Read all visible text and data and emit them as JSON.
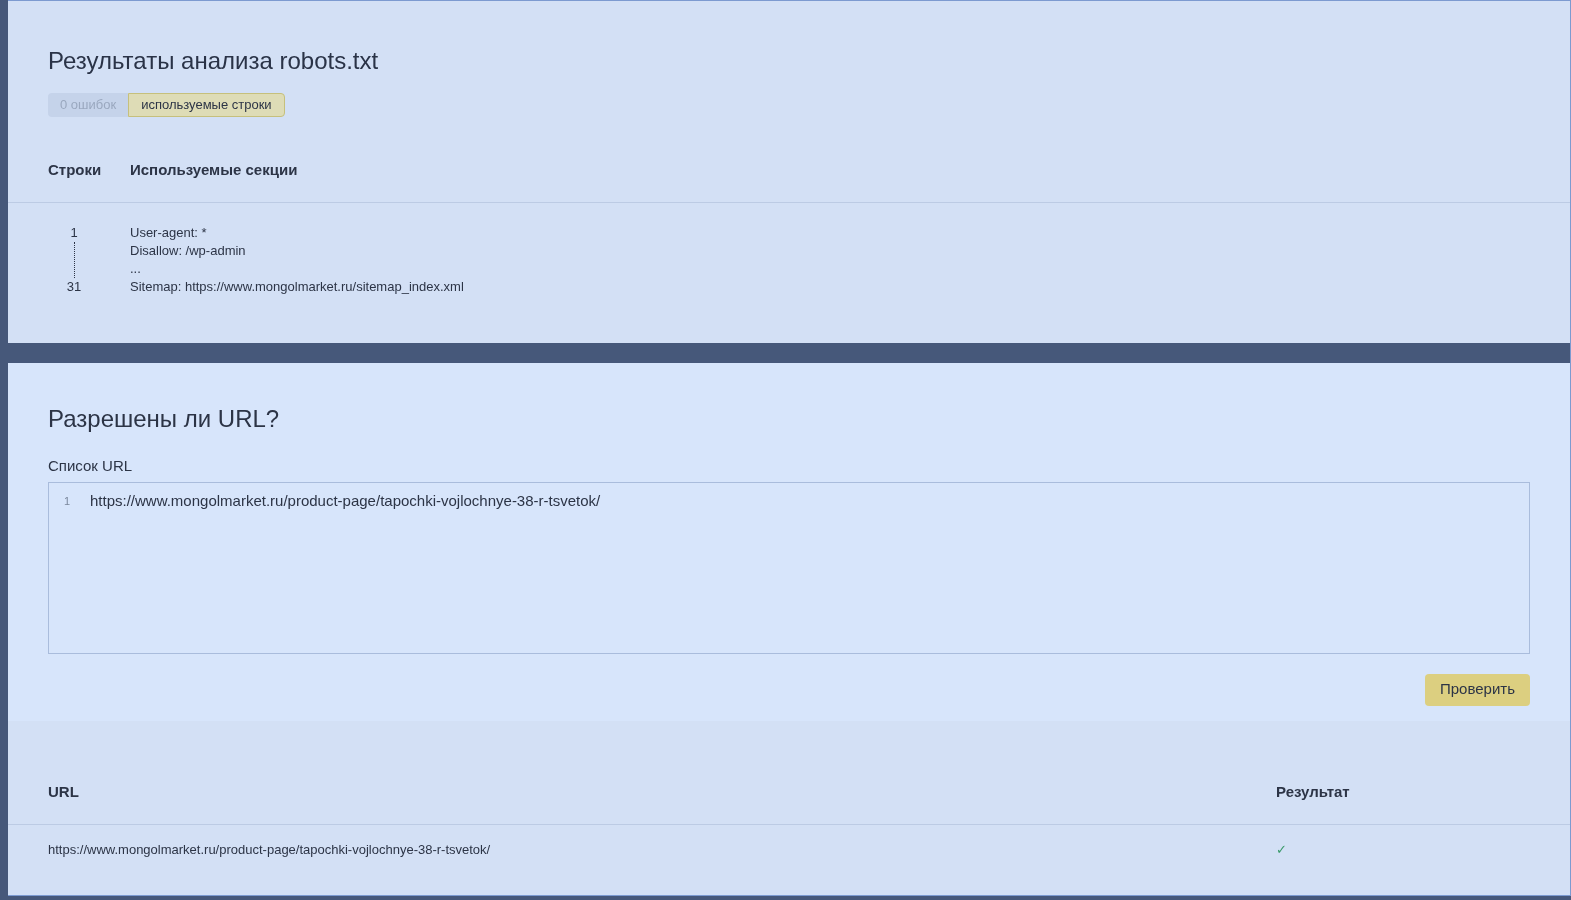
{
  "analysis": {
    "title": "Результаты анализа robots.txt",
    "tabs": [
      {
        "label": "0 ошибок",
        "selected": false
      },
      {
        "label": "используемые строки",
        "selected": true
      }
    ],
    "columns": [
      "Строки",
      "Используемые секции"
    ],
    "range": {
      "start": "1",
      "end": "31"
    },
    "lines": [
      "User-agent: *",
      "Disallow: /wp-admin",
      "...",
      "Sitemap: https://www.mongolmarket.ru/sitemap_index.xml"
    ]
  },
  "check": {
    "title": "Разрешены ли URL?",
    "field_label": "Список URL",
    "field_lines": [
      {
        "number": "1",
        "value": "https://www.mongolmarket.ru/product-page/tapochki-vojlochnye-38-r-tsvetok/"
      }
    ],
    "button": "Проверить"
  },
  "results": {
    "columns": [
      "URL",
      "Результат"
    ],
    "rows": [
      {
        "url": "https://www.mongolmarket.ru/product-page/tapochki-vojlochnye-38-r-tsvetok/",
        "result": "✓"
      }
    ]
  }
}
